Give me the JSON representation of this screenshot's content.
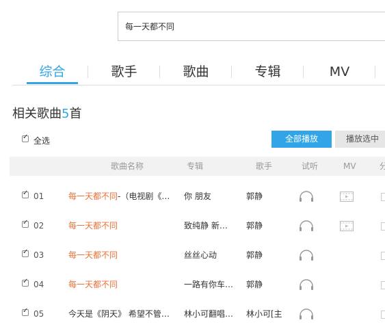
{
  "search": {
    "value": "每一天都不同"
  },
  "tabs": [
    {
      "label": "综合",
      "active": true
    },
    {
      "label": "歌手"
    },
    {
      "label": "歌曲"
    },
    {
      "label": "专辑"
    },
    {
      "label": "MV"
    }
  ],
  "section": {
    "title": "相关歌曲",
    "count": "5",
    "unit": "首"
  },
  "select_all_label": "全选",
  "buttons": {
    "play_all": "全部播放",
    "play_selected": "播放选中"
  },
  "columns": {
    "name": "歌曲名称",
    "album": "专辑",
    "artist": "歌手",
    "listen": "试听",
    "mv": "MV",
    "share": "分"
  },
  "songs": [
    {
      "num": "01",
      "title_hl": "每一天都不同",
      "title_rest": "-（电视剧《…",
      "album": "你 朋友",
      "artist": "郭静",
      "has_mv": true
    },
    {
      "num": "02",
      "title_hl": "每一天都不同",
      "title_rest": "",
      "album": "致纯静 新…",
      "artist": "郭静",
      "has_mv": true
    },
    {
      "num": "03",
      "title_hl": "每一天都不同",
      "title_rest": "",
      "album": "丝丝心动",
      "artist": "郭静",
      "has_mv": false
    },
    {
      "num": "04",
      "title_hl": "每一天都不同",
      "title_rest": "",
      "album": "一路有你车…",
      "artist": "郭静",
      "has_mv": false
    },
    {
      "num": "05",
      "title_hl": "",
      "title_rest": "今天是《阴天》 希望不管…",
      "album": "林小可翻唱…",
      "artist": "林小可[主",
      "has_mv": false
    }
  ],
  "colors": {
    "accent": "#31a5e7",
    "highlight": "#e8733a"
  }
}
